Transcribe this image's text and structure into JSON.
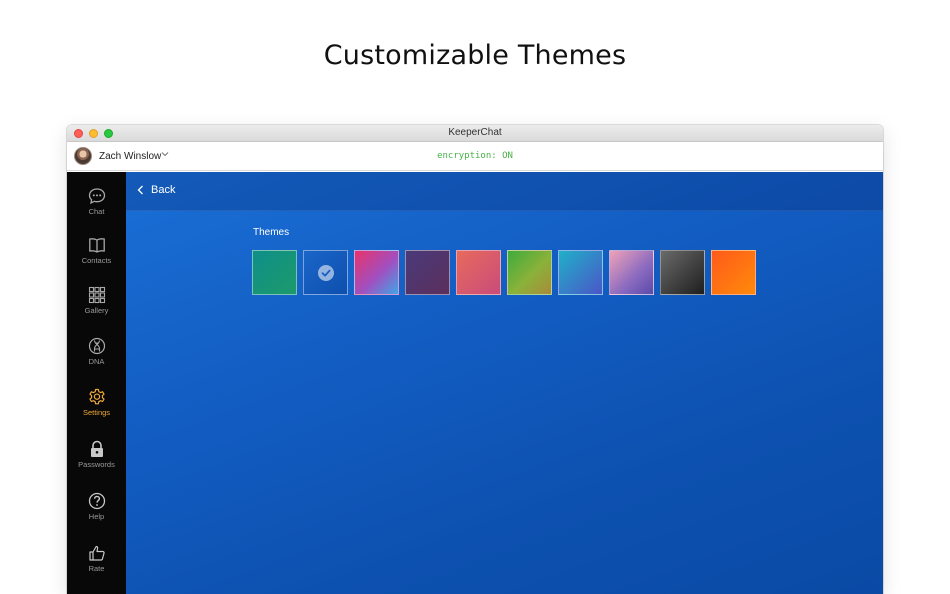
{
  "headline": "Customizable Themes",
  "window": {
    "title": "KeeperChat"
  },
  "userbar": {
    "user_name": "Zach Winslow",
    "encryption_status": "encryption: ON"
  },
  "sidebar": {
    "items": [
      {
        "label": "Chat",
        "icon": "chat-bubble-icon"
      },
      {
        "label": "Contacts",
        "icon": "book-icon"
      },
      {
        "label": "Gallery",
        "icon": "grid-icon"
      },
      {
        "label": "DNA",
        "icon": "dna-icon"
      },
      {
        "label": "Settings",
        "icon": "gear-icon",
        "active": true
      },
      {
        "label": "Passwords",
        "icon": "lock-icon"
      },
      {
        "label": "Help",
        "icon": "question-icon"
      },
      {
        "label": "Rate",
        "icon": "thumbs-up-icon"
      }
    ],
    "active_color": "#f0a93a"
  },
  "main": {
    "back_label": "Back",
    "themes_label": "Themes",
    "selected_theme_index": 1,
    "themes": [
      {
        "gradient": "linear-gradient(135deg, #0e8f8a, #1d9a6a)"
      },
      {
        "gradient": "linear-gradient(135deg, #1a66c9, #0e4fae)"
      },
      {
        "gradient": "linear-gradient(135deg, #e8336a, #a24fc0 55%, #3fa6e6)"
      },
      {
        "gradient": "linear-gradient(135deg, #4a3a7a, #5b2f5c)"
      },
      {
        "gradient": "linear-gradient(135deg, #e86a5c, #c84c7a)"
      },
      {
        "gradient": "linear-gradient(135deg, #3fab3c, #8ab23a 55%, #a98a3a)"
      },
      {
        "gradient": "linear-gradient(135deg, #1fb0c8, #4b56c8)"
      },
      {
        "gradient": "linear-gradient(135deg, #f0a2b8, #8a6ac0 60%, #5a4aa8)"
      },
      {
        "gradient": "linear-gradient(135deg, #6a6a6a, #1e1e1e)"
      },
      {
        "gradient": "linear-gradient(135deg, #ff5a1a, #ff8a0a)"
      }
    ]
  }
}
